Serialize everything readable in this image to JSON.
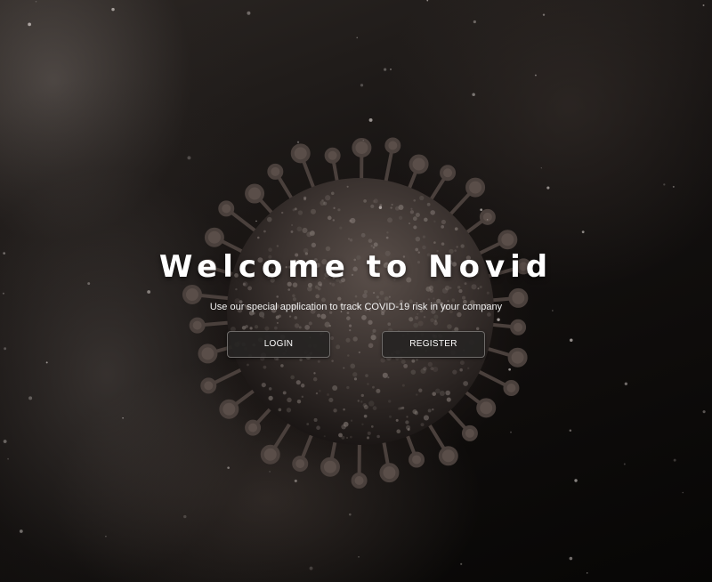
{
  "hero": {
    "title": "Welcome to Novid",
    "subtitle": "Use our special application to track COVID-19 risk in your company",
    "login_label": "LOGIN",
    "register_label": "REGISTER"
  },
  "colors": {
    "background": "#0a0807",
    "text": "#ffffff",
    "button_background": "#262423",
    "button_border": "#6e6b69"
  }
}
